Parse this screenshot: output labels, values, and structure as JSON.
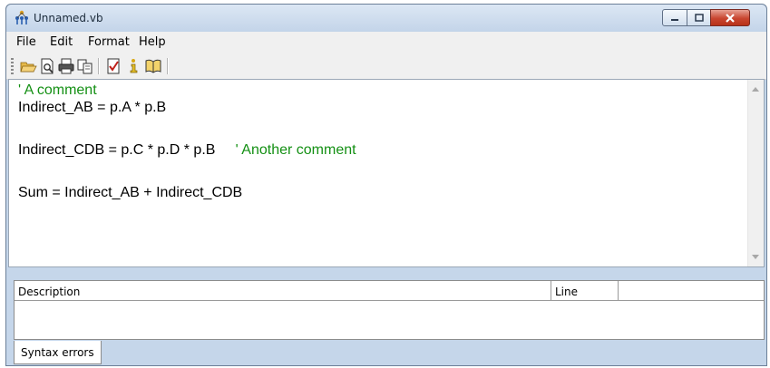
{
  "window": {
    "title": "Unnamed.vb",
    "icon": "network-nodes-icon",
    "controls": [
      "minimize",
      "maximize",
      "close"
    ]
  },
  "menu": {
    "items": [
      "File",
      "Edit",
      "Format",
      "Help"
    ]
  },
  "toolbar": {
    "buttons": [
      "open-folder-icon",
      "print-preview-icon",
      "print-icon",
      "copy-icon",
      "check-icon",
      "info-icon",
      "help-book-icon"
    ]
  },
  "editor": {
    "lines": [
      {
        "code": "",
        "comment": "' A comment"
      },
      {
        "code": "Indirect_AB = p.A * p.B",
        "comment": ""
      },
      {
        "code": "Indirect_CDB = p.C * p.D * p.B     ",
        "comment": "' Another comment"
      },
      {
        "code": "Sum = Indirect_AB + Indirect_CDB",
        "comment": ""
      }
    ]
  },
  "errors": {
    "columns": [
      "Description",
      "Line",
      ""
    ],
    "tab_label": "Syntax errors"
  }
}
